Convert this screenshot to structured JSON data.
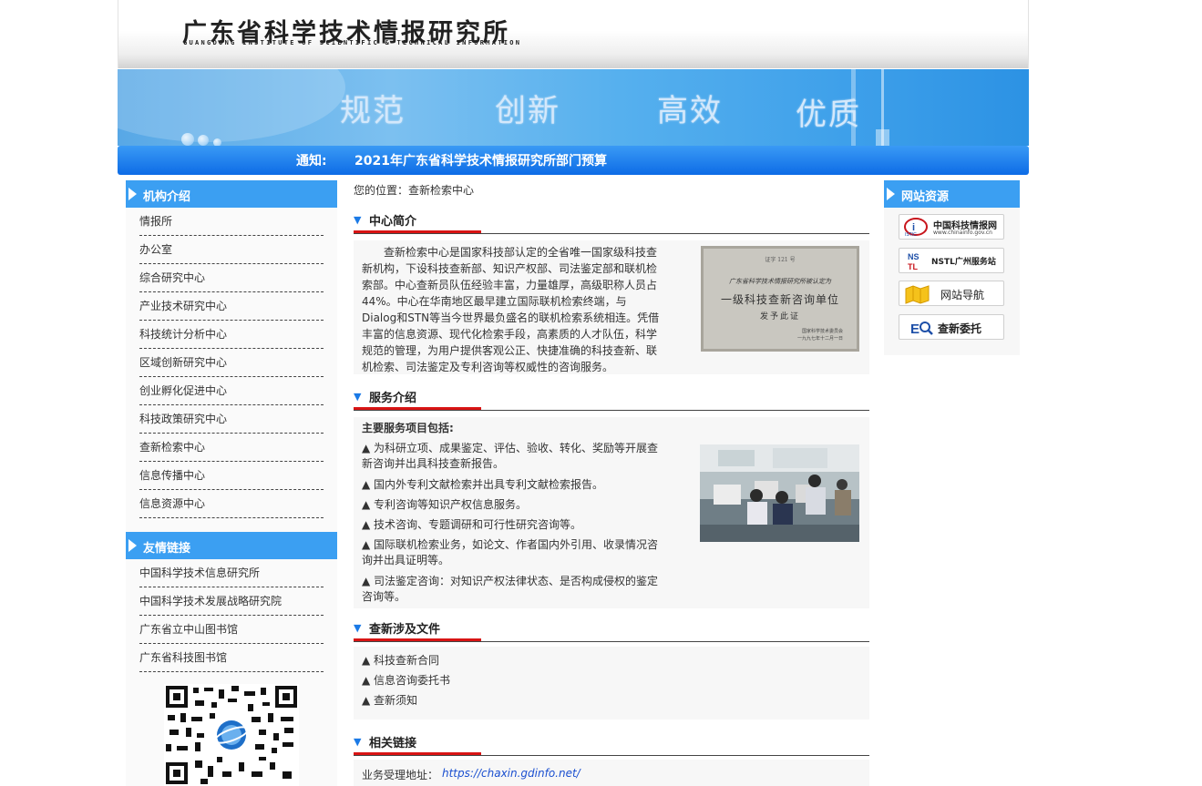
{
  "header": {
    "logo_cn": "广东省科学技术情报研究所",
    "logo_en": "GUANGDONG INSTITUTE OF SCIENTIFIC & TECHNICAL INFORMATION"
  },
  "banner": {
    "words": [
      "规范",
      "创新",
      "高效",
      "优质"
    ]
  },
  "notice": {
    "label": "通知:",
    "text": "2021年广东省科学技术情报研究所部门预算"
  },
  "left": {
    "org_title": "机构介绍",
    "org_items": [
      "情报所",
      "办公室",
      "综合研究中心",
      "产业技术研究中心",
      "科技统计分析中心",
      "区域创新研究中心",
      "创业孵化促进中心",
      "科技政策研究中心",
      "查新检索中心",
      "信息传播中心",
      "信息资源中心"
    ],
    "links_title": "友情链接",
    "link_items": [
      "中国科学技术信息研究所",
      "中国科学技术发展战略研究院",
      "广东省立中山图书馆",
      "广东省科技图书馆"
    ]
  },
  "breadcrumb": "您的位置：查新检索中心",
  "sections": {
    "intro": {
      "title": "中心简介",
      "text": "查新检索中心是国家科技部认定的全省唯一国家级科技查新机构，下设科技查新部、知识产权部、司法鉴定部和联机检索部。中心查新员队伍经验丰富，力量雄厚，高级职称人员占44%。中心在华南地区最早建立国际联机检索终端，与Dialog和STN等当今世界最负盛名的联机检索系统相连。凭借丰富的信息资源、现代化检索手段，高素质的人才队伍，科学规范的管理，为用户提供客观公正、快捷准确的科技查新、联机检索、司法鉴定及专利咨询等权威性的咨询服务。",
      "cert_lines": [
        "证字 121 号",
        "广东省科学技术情报研究所被认定为",
        "一级科技查新咨询单位",
        "发予此证",
        "国家科学技术委员会",
        "一九九七年十二月一日"
      ]
    },
    "services": {
      "title": "服务介绍",
      "subtitle": "主要服务项目包括:",
      "items": [
        "▲ 为科研立项、成果鉴定、评估、验收、转化、奖励等开展查新咨询并出具科技查新报告。",
        "▲ 国内外专利文献检索并出具专利文献检索报告。",
        "▲ 专利咨询等知识产权信息服务。",
        "▲ 技术咨询、专题调研和可行性研究咨询等。",
        "▲ 国际联机检索业务，如论文、作者国内外引用、收录情况咨询并出具证明等。",
        "▲ 司法鉴定咨询：对知识产权法律状态、是否构成侵权的鉴定咨询等。"
      ]
    },
    "docs": {
      "title": "查新涉及文件",
      "items": [
        "▲ 科技查新合同",
        "▲ 信息咨询委托书",
        "▲ 查新须知"
      ]
    },
    "links": {
      "title": "相关链接",
      "label": "业务受理地址：",
      "url": "https://chaxin.gdinfo.net/"
    }
  },
  "right": {
    "title": "网站资源",
    "resources": [
      {
        "label": "中国科技情报网",
        "sub": "www.chinainfo.gov.cn",
        "icon": "istic-logo-icon"
      },
      {
        "label": "NSTL广州服务站",
        "sub": "",
        "icon": "nstl-logo-icon"
      },
      {
        "label": "网站导航",
        "sub": "",
        "icon": "map-icon"
      },
      {
        "label": "查新委托",
        "sub": "",
        "icon": "search-commission-icon"
      }
    ]
  },
  "colors": {
    "accent_blue": "#3b9ff2",
    "notice_blue": "#0d6ce6",
    "red_underline": "#d81414"
  }
}
